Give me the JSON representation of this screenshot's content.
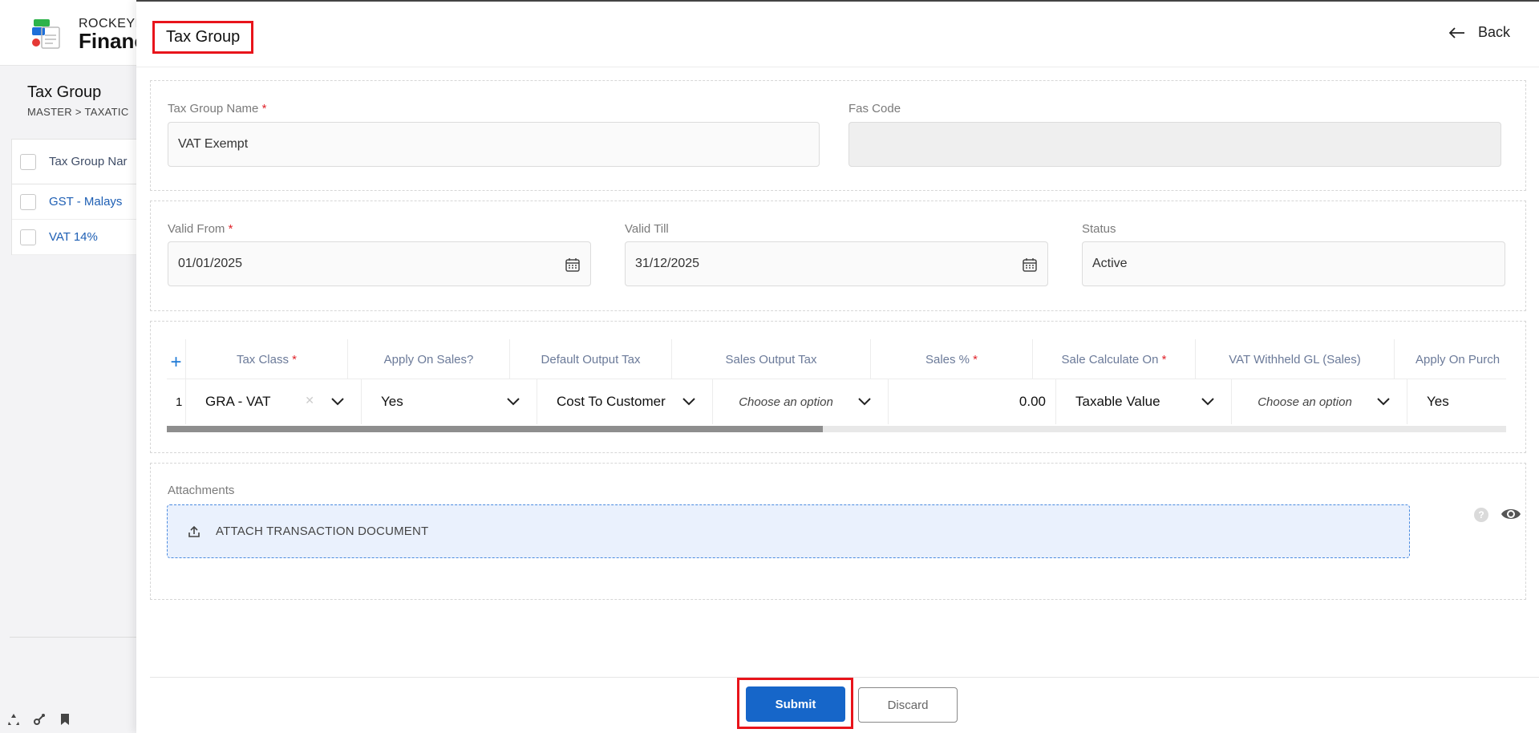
{
  "background": {
    "brand_top": "ROCKEYE",
    "brand_main": "Financ",
    "page_title": "Tax Group",
    "breadcrumb": "MASTER  >  TAXATIC",
    "table_header": "Tax Group Nar",
    "rows": [
      "GST - Malays",
      "VAT 14%"
    ]
  },
  "drawer": {
    "title": "Tax Group",
    "back_label": "Back"
  },
  "form": {
    "tax_group_name_label": "Tax Group Name",
    "tax_group_name_value": "VAT Exempt",
    "fas_code_label": "Fas Code",
    "fas_code_value": "",
    "valid_from_label": "Valid From",
    "valid_from_value": "01/01/2025",
    "valid_till_label": "Valid Till",
    "valid_till_value": "31/12/2025",
    "status_label": "Status",
    "status_value": "Active",
    "required_mark": "*"
  },
  "grid": {
    "add_symbol": "+",
    "headers": {
      "tax_class": "Tax Class",
      "apply_on_sales": "Apply On Sales?",
      "default_output_tax": "Default Output Tax",
      "sales_output_tax": "Sales Output Tax",
      "sales_pct": "Sales %",
      "sale_calculate_on": "Sale Calculate On",
      "vat_withheld": "VAT Withheld GL (Sales)",
      "apply_on_purch": "Apply On Purch"
    },
    "row": {
      "index": "1",
      "tax_class": "GRA - VAT",
      "apply_on_sales": "Yes",
      "default_output_tax": "Cost To Customer",
      "sales_output_tax": "Choose an option",
      "sales_pct": "0.00",
      "sale_calculate_on": "Taxable Value",
      "vat_withheld": "Choose an option",
      "apply_on_purch": "Yes"
    },
    "scroll_fraction": 0.49
  },
  "attachments": {
    "label": "Attachments",
    "button_label": "ATTACH TRANSACTION DOCUMENT",
    "help_symbol": "?"
  },
  "footer": {
    "submit_label": "Submit",
    "discard_label": "Discard"
  },
  "colors": {
    "primary": "#1666c9",
    "highlight": "#e8141b",
    "link": "#1e5fb4"
  }
}
